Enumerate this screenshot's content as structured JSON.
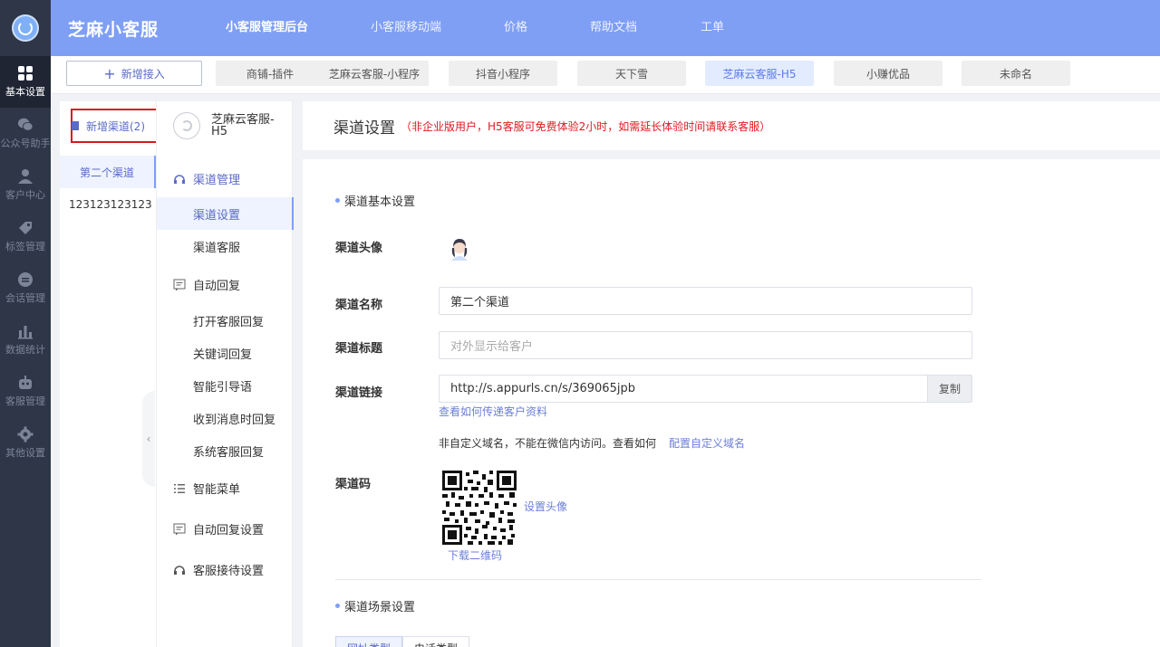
{
  "app": {
    "brand": "芝麻小客服"
  },
  "sidebar": {
    "items": [
      {
        "label": "基本设置",
        "icon": "grid-icon"
      },
      {
        "label": "公众号助手",
        "icon": "wechat-icon"
      },
      {
        "label": "客户中心",
        "icon": "users-icon"
      },
      {
        "label": "标签管理",
        "icon": "tag-icon"
      },
      {
        "label": "会话管理",
        "icon": "chat-icon"
      },
      {
        "label": "数据统计",
        "icon": "bar-chart-icon"
      },
      {
        "label": "客服管理",
        "icon": "robot-icon"
      },
      {
        "label": "其他设置",
        "icon": "gear-icon"
      }
    ]
  },
  "topnav": {
    "items": [
      "小客服管理后台",
      "小客服移动端",
      "价格",
      "帮助文档",
      "工单"
    ]
  },
  "tabstrip": {
    "new_label": "新增接入",
    "tabs": [
      "商铺-插件",
      "芝麻云客服-小程序",
      "抖音小程序",
      "天下雪",
      "芝麻云客服-H5",
      "小赚优品",
      "未命名"
    ]
  },
  "channels": {
    "add_label": "新增渠道(2)",
    "items": [
      "第二个渠道",
      "123123123123"
    ]
  },
  "menu": {
    "channel_name": "芝麻云客服-H5",
    "groups": {
      "channel_mgmt": "渠道管理",
      "auto_reply": "自动回复",
      "smart_menu": "智能菜单",
      "auto_reply_settings": "自动回复设置",
      "reception_settings": "客服接待设置"
    },
    "channel_items": [
      "渠道设置",
      "渠道客服"
    ],
    "auto_reply_items": [
      "打开客服回复",
      "关键词回复",
      "智能引导语",
      "收到消息时回复",
      "系统客服回复"
    ]
  },
  "main": {
    "title": "渠道设置",
    "notice": "（非企业版用户，H5客服可免费体验2小时，如需延长体验时间请联系客服）",
    "basic_section": "渠道基本设置",
    "avatar_label": "渠道头像",
    "name_label": "渠道名称",
    "name_value": "第二个渠道",
    "title_label": "渠道标题",
    "title_placeholder": "对外显示给客户",
    "link_label": "渠道链接",
    "link_value": "http://s.appurls.cn/s/369065jpb",
    "copy_label": "复制",
    "pass_info_link": "查看如何传递客户资料",
    "domain_note": "非自定义域名，不能在微信内访问。查看如何",
    "domain_link": "配置自定义域名",
    "qrcode_label": "渠道码",
    "set_avatar": "设置头像",
    "download_qr": "下载二维码",
    "scene_section": "渠道场景设置",
    "scene_tabs": [
      "网址类型",
      "电话类型"
    ]
  },
  "colors": {
    "header": "#7f9ff5",
    "rail": "#2e3648",
    "accent": "#5a6ac8",
    "warning": "#e0191f"
  }
}
